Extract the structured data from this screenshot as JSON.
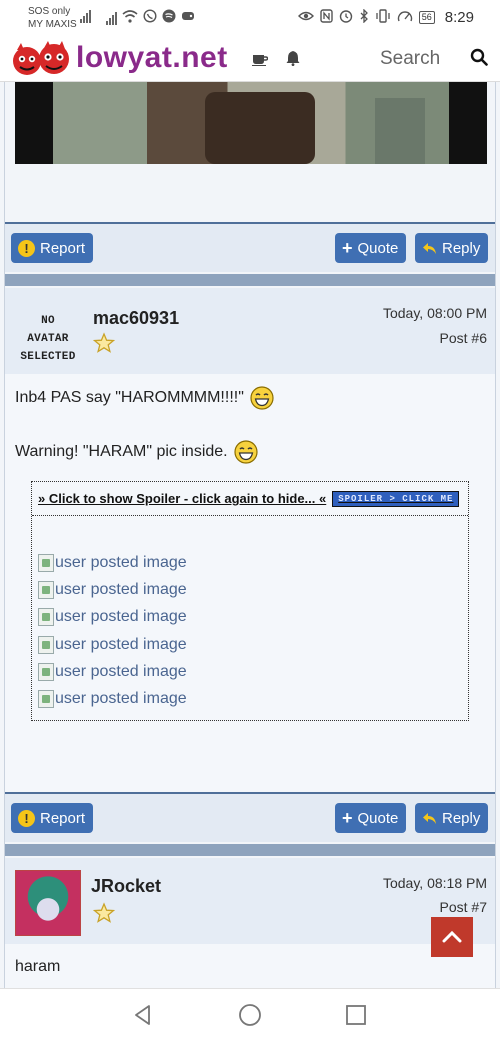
{
  "statusbar": {
    "carrier_line1": "SOS only",
    "carrier_line2": "MY MAXIS",
    "battery_level": "56",
    "time": "8:29"
  },
  "header": {
    "site_name": "lowyat.net",
    "search_placeholder": "Search"
  },
  "post_footer_buttons": {
    "report": "Report",
    "quote": "Quote",
    "reply": "Reply"
  },
  "posts": [
    {
      "avatar_text_line1": "NO AVATAR",
      "avatar_text_line2": "SELECTED",
      "username": "mac60931",
      "date": "Today, 08:00 PM",
      "post_number": "Post #6",
      "line1": "Inb4 PAS say \"HAROMMMM!!!!\"",
      "line2": "Warning! \"HARAM\" pic inside.",
      "spoiler_label": "» Click to show Spoiler - click again to hide... «",
      "spoiler_badge": "SPOILER > CLICK ME",
      "images": [
        "user posted image",
        "user posted image",
        "user posted image",
        "user posted image",
        "user posted image",
        "user posted image"
      ]
    },
    {
      "username": "JRocket",
      "date": "Today, 08:18 PM",
      "post_number": "Post #7",
      "line1": "haram"
    }
  ],
  "colors": {
    "brand": "#8a2a8a",
    "button_blue": "#3f6fb3",
    "scroll_top_red": "#c0392b"
  }
}
